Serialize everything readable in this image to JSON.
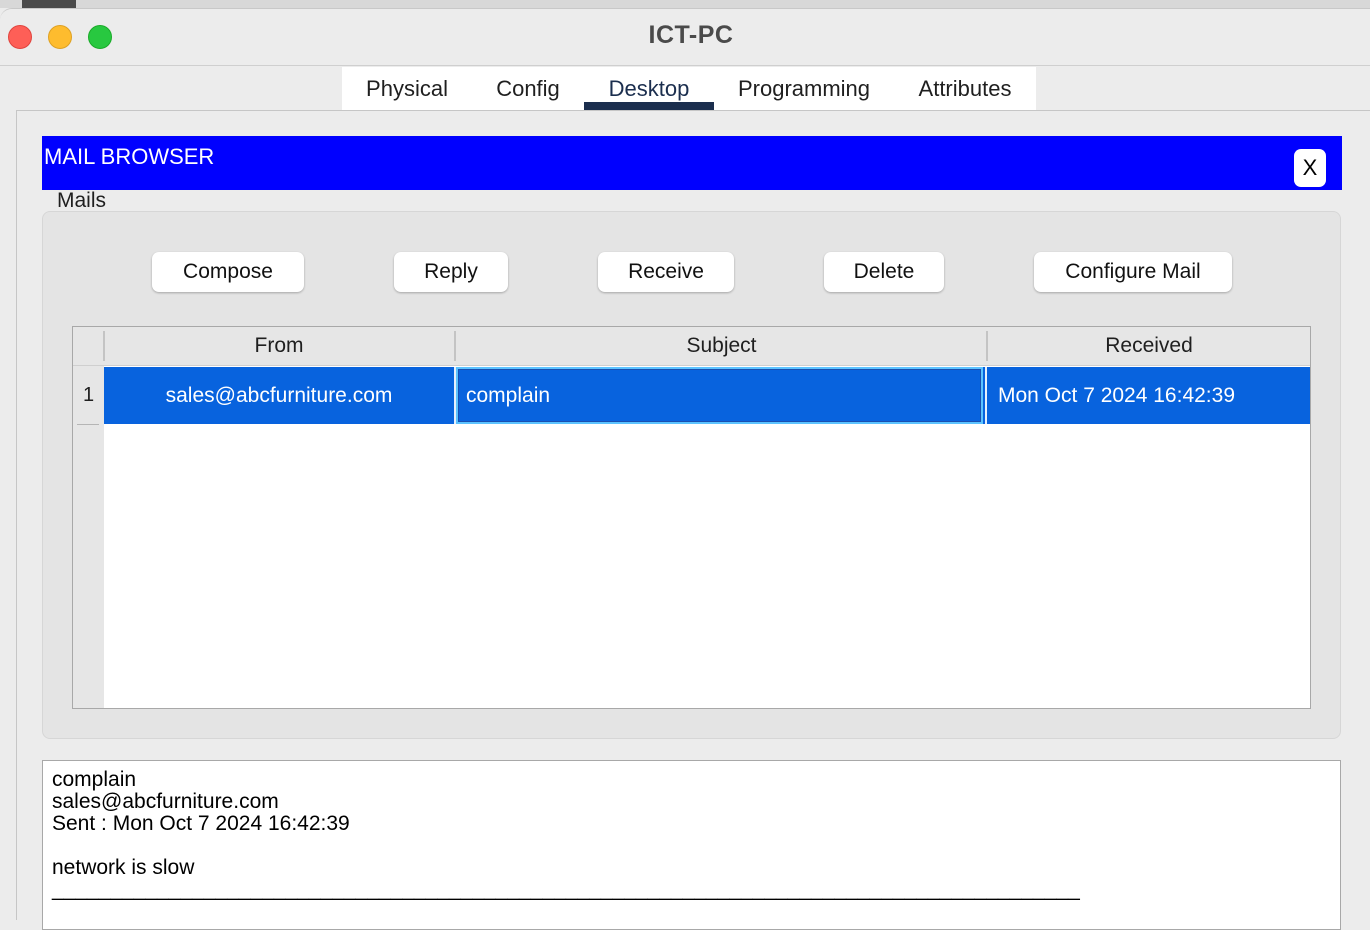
{
  "window": {
    "title": "ICT-PC"
  },
  "tabs": [
    "Physical",
    "Config",
    "Desktop",
    "Programming",
    "Attributes"
  ],
  "active_tab": "Desktop",
  "mail_browser": {
    "title": "MAIL BROWSER",
    "close_label": "X",
    "group_label": "Mails",
    "buttons": {
      "compose": "Compose",
      "reply": "Reply",
      "receive": "Receive",
      "delete": "Delete",
      "configure": "Configure Mail"
    },
    "table": {
      "columns": [
        "From",
        "Subject",
        "Received"
      ],
      "rows": [
        {
          "num": "1",
          "from": "sales@abcfurniture.com",
          "subject": "complain",
          "received": "Mon Oct 7 2024 16:42:39"
        }
      ]
    },
    "message": {
      "subject": "complain",
      "from": "sales@abcfurniture.com",
      "sent": "Sent : Mon Oct 7 2024 16:42:39",
      "body": "network is slow",
      "separator": "________________________________________________________________________________________"
    }
  },
  "colors": {
    "header_blue": "#0000ff",
    "selection_blue": "#0863de",
    "tab_active": "#1b2e4e"
  }
}
